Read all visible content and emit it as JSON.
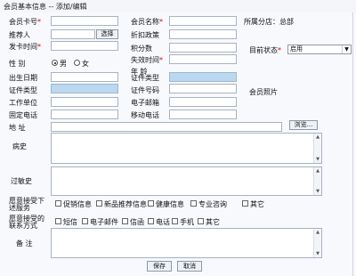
{
  "window": {
    "title": "会员基本信息 -- 添加/编辑"
  },
  "fields": {
    "member_no": {
      "label": "会员卡号",
      "value": ""
    },
    "member_name": {
      "label": "会员名称",
      "value": ""
    },
    "recommender": {
      "label": "推荐人",
      "value": "",
      "button": "选择"
    },
    "discount_policy": {
      "label": "折扣政策",
      "value": ""
    },
    "points": {
      "label": "积分数",
      "value": ""
    },
    "issue_date": {
      "label": "发卡时间",
      "value": ""
    },
    "expire_date": {
      "label": "失效时间",
      "value": ""
    },
    "status": {
      "label": "目前状态",
      "value": "启用"
    },
    "gender": {
      "label": "性  别",
      "options": [
        "男",
        "女"
      ],
      "selected": "男"
    },
    "age": {
      "label": "年  龄",
      "value": ""
    },
    "birthday": {
      "label": "出生日期",
      "value": ""
    },
    "id_type": {
      "label": "证件类型",
      "value": ""
    },
    "id_number": {
      "label": "证件号码",
      "value": ""
    },
    "work_unit": {
      "label": "工作单位",
      "value": ""
    },
    "email": {
      "label": "电子邮箱",
      "value": ""
    },
    "home_phone": {
      "label": "固定电话",
      "value": ""
    },
    "mobile": {
      "label": "移动电话",
      "value": ""
    },
    "address": {
      "label": "地  址",
      "value": ""
    },
    "history": {
      "label": "病史",
      "value": ""
    },
    "allergy": {
      "label": "过敏史",
      "value": ""
    },
    "remark": {
      "label": "备  注",
      "value": ""
    }
  },
  "side": {
    "shop_label": "所属分店：总部",
    "photo_label": "会员照片",
    "browse_button": "浏览..."
  },
  "service_items": {
    "label": "愿意接受下述服务",
    "options": [
      "促销信息",
      "新品推荐信息",
      "健康信息",
      "专业咨询",
      "其它"
    ]
  },
  "contact_methods": {
    "label": "愿意接受的联系方式",
    "options": [
      "短信",
      "电子邮件",
      "信函",
      "电话",
      "手机",
      "其它"
    ]
  },
  "footer": {
    "save": "保存",
    "cancel": "取消"
  }
}
